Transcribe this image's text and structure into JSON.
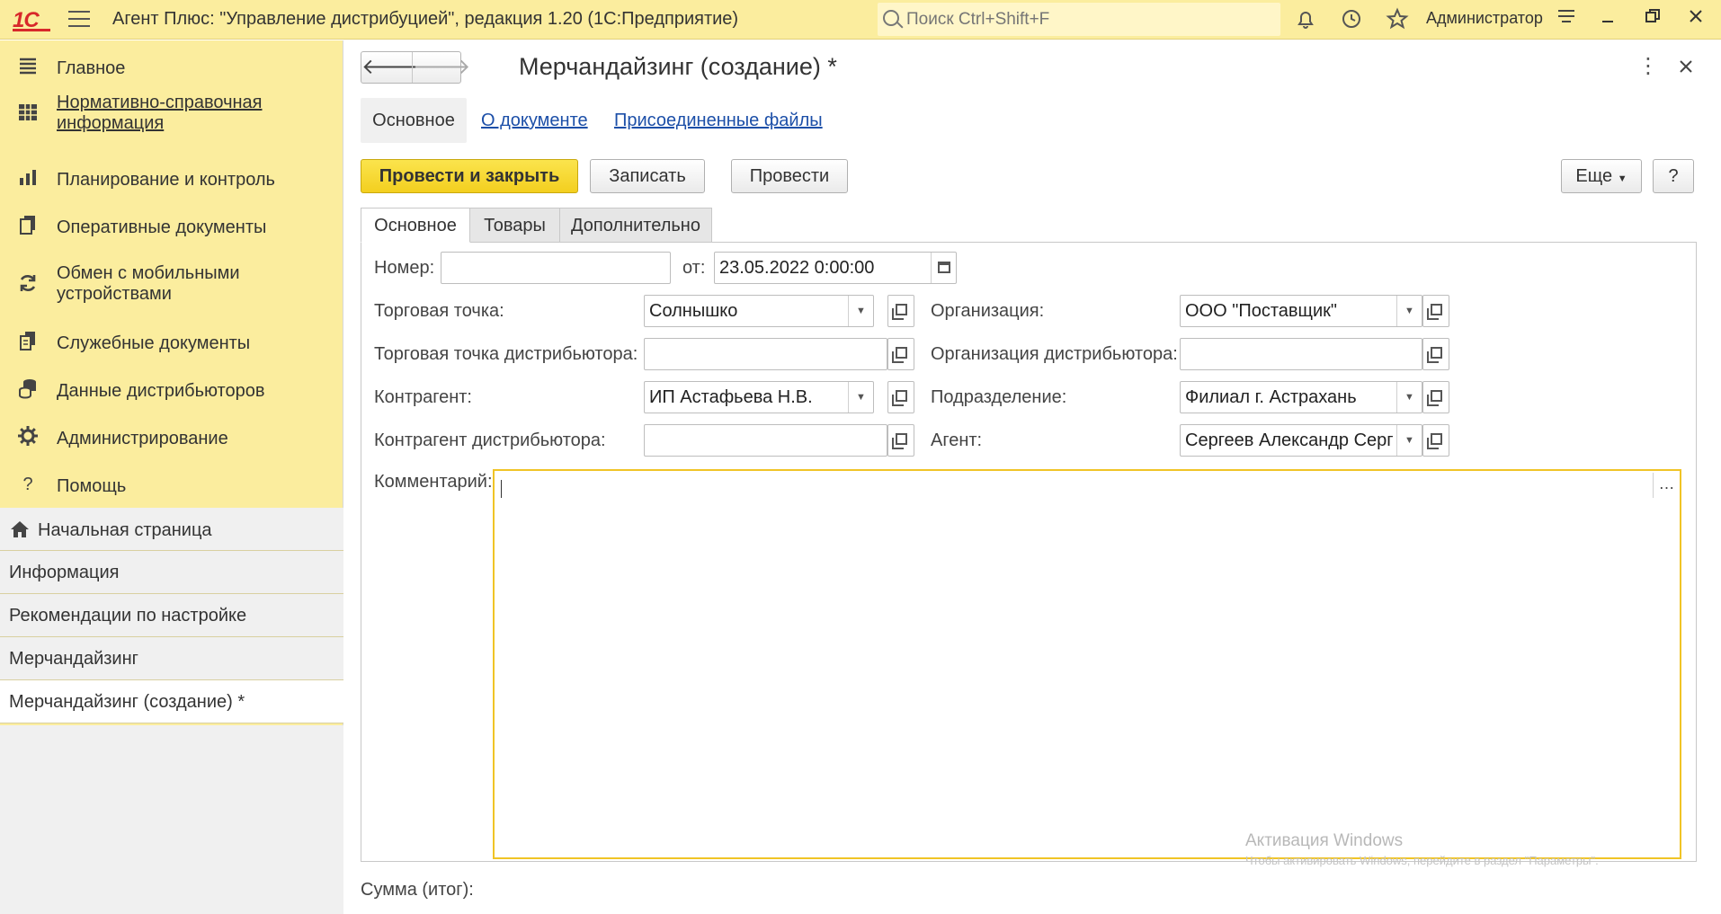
{
  "titlebar": {
    "logo": "1С",
    "title": "Агент Плюс: \"Управление дистрибуцией\", редакция 1.20  (1С:Предприятие)",
    "search_placeholder": "Поиск Ctrl+Shift+F",
    "user": "Администратор",
    "icons": [
      "bell-icon",
      "history-icon",
      "star-icon",
      "menu-lines-icon",
      "minimize-icon",
      "restore-icon",
      "close-icon"
    ]
  },
  "sidebar": {
    "items": [
      {
        "label": "Главное",
        "icon": "menu-lines-icon"
      },
      {
        "label": "Нормативно-справочная информация",
        "icon": "grid-icon"
      },
      {
        "label": "Планирование и контроль",
        "icon": "bar-chart-icon"
      },
      {
        "label": "Оперативные документы",
        "icon": "documents-icon"
      },
      {
        "label": "Обмен с мобильными устройствами",
        "icon": "sync-icon"
      },
      {
        "label": "Служебные документы",
        "icon": "service-documents-icon"
      },
      {
        "label": "Данные дистрибьюторов",
        "icon": "database-icon"
      },
      {
        "label": "Администрирование",
        "icon": "gear-icon"
      },
      {
        "label": "Помощь",
        "icon": "question-icon"
      }
    ],
    "open_windows": [
      {
        "label": "Начальная страница",
        "icon": "home-icon"
      },
      {
        "label": "Информация"
      },
      {
        "label": "Рекомендации по настройке"
      },
      {
        "label": "Мерчандайзинг"
      },
      {
        "label": "Мерчандайзинг (создание) *"
      }
    ]
  },
  "form": {
    "title": "Мерчандайзинг (создание) *",
    "section_tabs": [
      "Основное",
      "О документе",
      "Присоединенные файлы"
    ],
    "buttons": {
      "post_close": "Провести и закрыть",
      "save": "Записать",
      "post": "Провести",
      "more": "Еще",
      "help": "?"
    },
    "tabs": [
      "Основное",
      "Товары",
      "Дополнительно"
    ],
    "fields": {
      "number_label": "Номер:",
      "number_value": "",
      "date_label": "от:",
      "date_value": "23.05.2022  0:00:00",
      "outlet_label": "Торговая точка:",
      "outlet_value": "Солнышко",
      "org_label": "Организация:",
      "org_value": "ООО \"Поставщик\"",
      "dist_outlet_label": "Торговая точка дистрибьютора:",
      "dist_outlet_value": "",
      "dist_org_label": "Организация дистрибьютора:",
      "dist_org_value": "",
      "contractor_label": "Контрагент:",
      "contractor_value": "ИП Астафьева Н.В.",
      "division_label": "Подразделение:",
      "division_value": "Филиал г. Астрахань",
      "dist_contractor_label": "Контрагент дистрибьютора:",
      "dist_contractor_value": "",
      "agent_label": "Агент:",
      "agent_value": "Сергеев Александр Серг",
      "comment_label": "Комментарий:",
      "comment_value": ""
    },
    "total_label": "Сумма (итог):"
  },
  "watermark": {
    "line1": "Активация Windows",
    "line2": "Чтобы активировать Windows, перейдите в раздел \"Параметры\"."
  }
}
